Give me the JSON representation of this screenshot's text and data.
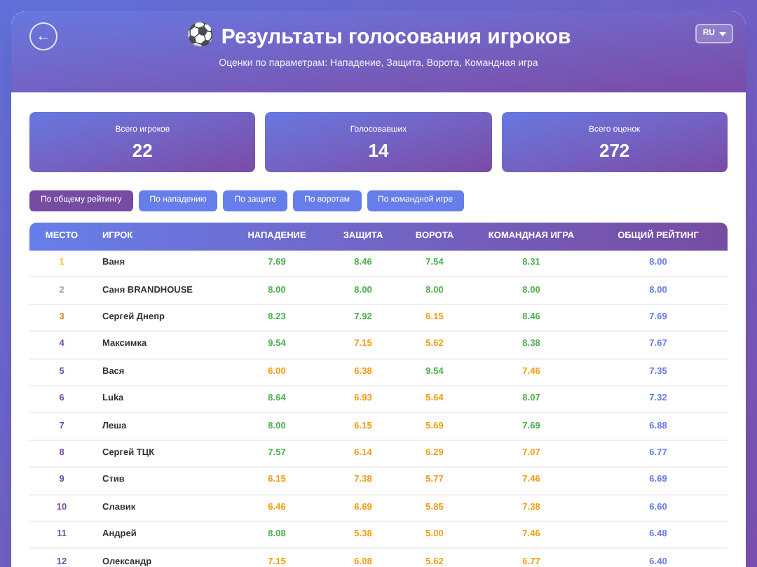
{
  "header": {
    "back_icon": "←",
    "icon": "⚽",
    "title": "Результаты голосования игроков",
    "subtitle": "Оценки по параметрам: Нападение, Защита, Ворота, Командная игра",
    "language": "RU"
  },
  "stats": [
    {
      "label": "Всего игроков",
      "value": "22"
    },
    {
      "label": "Голосовавших",
      "value": "14"
    },
    {
      "label": "Всего оценок",
      "value": "272"
    }
  ],
  "sort_tabs": [
    {
      "label": "По общему рейтингу",
      "selected": true
    },
    {
      "label": "По нападению",
      "selected": false
    },
    {
      "label": "По защите",
      "selected": false
    },
    {
      "label": "По воротам",
      "selected": false
    },
    {
      "label": "По командной игре",
      "selected": false
    }
  ],
  "table": {
    "columns": [
      "МЕСТО",
      "ИГРОК",
      "НАПАДЕНИЕ",
      "ЗАЩИТА",
      "ВОРОТА",
      "КОМАНДНАЯ ИГРА",
      "ОБЩИЙ РЕЙТИНГ"
    ],
    "rows": [
      {
        "place": "1",
        "color": "#f5c518",
        "player": "Ваня",
        "scores": [
          {
            "value": "7.69",
            "color": "#4caf50"
          },
          {
            "value": "8.46",
            "color": "#4caf50"
          },
          {
            "value": "7.54",
            "color": "#4caf50"
          },
          {
            "value": "8.31",
            "color": "#4caf50"
          }
        ],
        "overall": "8.00"
      },
      {
        "place": "2",
        "color": "#a0a0a0",
        "player": "Саня BRANDHOUSE",
        "scores": [
          {
            "value": "8.00",
            "color": "#4caf50"
          },
          {
            "value": "8.00",
            "color": "#4caf50"
          },
          {
            "value": "8.00",
            "color": "#4caf50"
          },
          {
            "value": "8.00",
            "color": "#4caf50"
          }
        ],
        "overall": "8.00"
      },
      {
        "place": "3",
        "color": "#d9822b",
        "player": "Сергей Днепр",
        "scores": [
          {
            "value": "8.23",
            "color": "#4caf50"
          },
          {
            "value": "7.92",
            "color": "#4caf50"
          },
          {
            "value": "6.15",
            "color": "#f39c12"
          },
          {
            "value": "8.46",
            "color": "#4caf50"
          }
        ],
        "overall": "7.69"
      },
      {
        "place": "4",
        "color": "#764ba2",
        "player": "Максимка",
        "scores": [
          {
            "value": "9.54",
            "color": "#4caf50"
          },
          {
            "value": "7.15",
            "color": "#f39c12"
          },
          {
            "value": "5.62",
            "color": "#f39c12"
          },
          {
            "value": "8.38",
            "color": "#4caf50"
          }
        ],
        "overall": "7.67"
      },
      {
        "place": "5",
        "color": "#764ba2",
        "player": "Вася",
        "scores": [
          {
            "value": "6.00",
            "color": "#f39c12"
          },
          {
            "value": "6.38",
            "color": "#f39c12"
          },
          {
            "value": "9.54",
            "color": "#4caf50"
          },
          {
            "value": "7.46",
            "color": "#f39c12"
          }
        ],
        "overall": "7.35"
      },
      {
        "place": "6",
        "color": "#764ba2",
        "player": "Luka",
        "scores": [
          {
            "value": "8.64",
            "color": "#4caf50"
          },
          {
            "value": "6.93",
            "color": "#f39c12"
          },
          {
            "value": "5.64",
            "color": "#f39c12"
          },
          {
            "value": "8.07",
            "color": "#4caf50"
          }
        ],
        "overall": "7.32"
      },
      {
        "place": "7",
        "color": "#764ba2",
        "player": "Леша",
        "scores": [
          {
            "value": "8.00",
            "color": "#4caf50"
          },
          {
            "value": "6.15",
            "color": "#f39c12"
          },
          {
            "value": "5.69",
            "color": "#f39c12"
          },
          {
            "value": "7.69",
            "color": "#4caf50"
          }
        ],
        "overall": "6.88"
      },
      {
        "place": "8",
        "color": "#764ba2",
        "player": "Сергей ТЦК",
        "scores": [
          {
            "value": "7.57",
            "color": "#4caf50"
          },
          {
            "value": "6.14",
            "color": "#f39c12"
          },
          {
            "value": "6.29",
            "color": "#f39c12"
          },
          {
            "value": "7.07",
            "color": "#f39c12"
          }
        ],
        "overall": "6.77"
      },
      {
        "place": "9",
        "color": "#764ba2",
        "player": "Стив",
        "scores": [
          {
            "value": "6.15",
            "color": "#f39c12"
          },
          {
            "value": "7.38",
            "color": "#f39c12"
          },
          {
            "value": "5.77",
            "color": "#f39c12"
          },
          {
            "value": "7.46",
            "color": "#f39c12"
          }
        ],
        "overall": "6.69"
      },
      {
        "place": "10",
        "color": "#764ba2",
        "player": "Славик",
        "scores": [
          {
            "value": "6.46",
            "color": "#f39c12"
          },
          {
            "value": "6.69",
            "color": "#f39c12"
          },
          {
            "value": "5.85",
            "color": "#f39c12"
          },
          {
            "value": "7.38",
            "color": "#f39c12"
          }
        ],
        "overall": "6.60"
      },
      {
        "place": "11",
        "color": "#764ba2",
        "player": "Андрей",
        "scores": [
          {
            "value": "8.08",
            "color": "#4caf50"
          },
          {
            "value": "5.38",
            "color": "#f39c12"
          },
          {
            "value": "5.00",
            "color": "#f39c12"
          },
          {
            "value": "7.46",
            "color": "#f39c12"
          }
        ],
        "overall": "6.48"
      },
      {
        "place": "12",
        "color": "#764ba2",
        "player": "Олександр",
        "scores": [
          {
            "value": "7.15",
            "color": "#f39c12"
          },
          {
            "value": "6.08",
            "color": "#f39c12"
          },
          {
            "value": "5.62",
            "color": "#f39c12"
          },
          {
            "value": "6.77",
            "color": "#f39c12"
          }
        ],
        "overall": "6.40"
      }
    ]
  }
}
